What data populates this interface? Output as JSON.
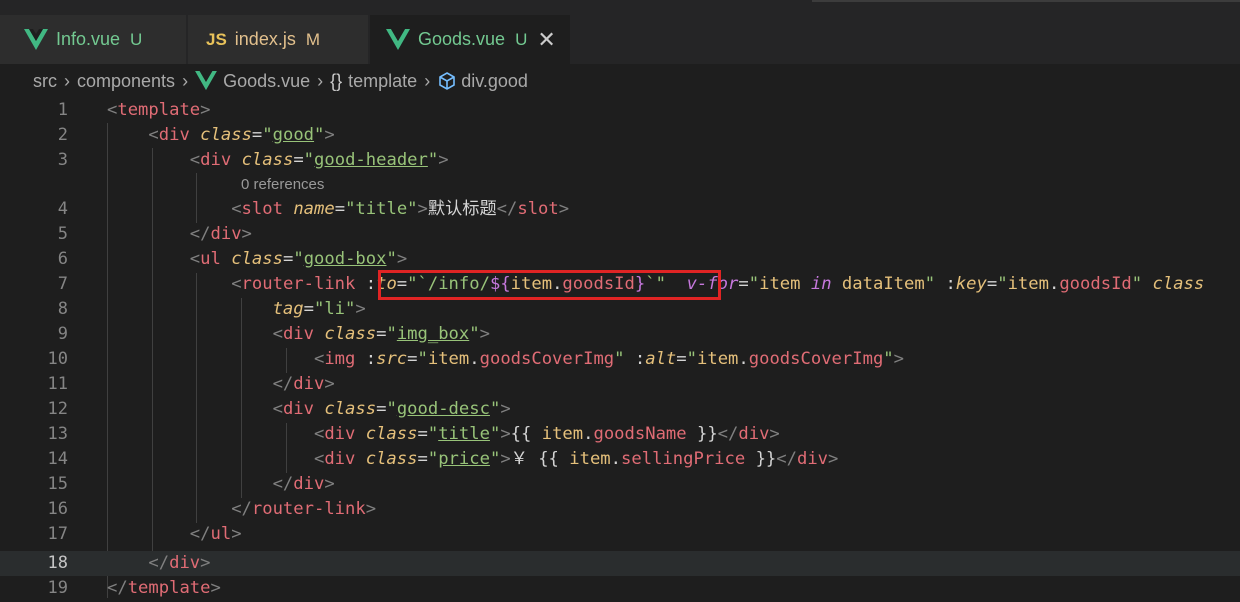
{
  "tabs": [
    {
      "label": "Info.vue",
      "status": "U",
      "icon": "vue-icon"
    },
    {
      "label": "index.js",
      "status": "M",
      "icon": "js-icon",
      "icon_text": "JS"
    },
    {
      "label": "Goods.vue",
      "status": "U",
      "icon": "vue-icon",
      "active": true,
      "close": "✕"
    }
  ],
  "breadcrumb": {
    "items": [
      "src",
      "components",
      "Goods.vue",
      "template",
      "div.good"
    ],
    "template_icon": "{}"
  },
  "editor": {
    "codelens": "0 references",
    "active_line": 18,
    "lines": [
      {
        "n": "1",
        "tokens": [
          [
            "br",
            "<"
          ],
          [
            "tag",
            "template"
          ],
          [
            "br",
            ">"
          ]
        ]
      },
      {
        "n": "2",
        "tokens": [
          [
            "t",
            "    "
          ],
          [
            "br",
            "<"
          ],
          [
            "tag",
            "div"
          ],
          [
            "t",
            " "
          ],
          [
            "attr",
            "class"
          ],
          [
            "eq",
            "="
          ],
          [
            "str",
            "\""
          ],
          [
            "cls",
            "good"
          ],
          [
            "str",
            "\""
          ],
          [
            "br",
            ">"
          ]
        ]
      },
      {
        "n": "3",
        "tokens": [
          [
            "t",
            "        "
          ],
          [
            "br",
            "<"
          ],
          [
            "tag",
            "div"
          ],
          [
            "t",
            " "
          ],
          [
            "attr",
            "class"
          ],
          [
            "eq",
            "="
          ],
          [
            "str",
            "\""
          ],
          [
            "cls",
            "good-header"
          ],
          [
            "str",
            "\""
          ],
          [
            "br",
            ">"
          ]
        ]
      },
      {
        "n": "4",
        "tokens": [
          [
            "t",
            "            "
          ],
          [
            "br",
            "<"
          ],
          [
            "tag",
            "slot"
          ],
          [
            "t",
            " "
          ],
          [
            "attr",
            "name"
          ],
          [
            "eq",
            "="
          ],
          [
            "str",
            "\"title\""
          ],
          [
            "br",
            ">"
          ],
          [
            "txt",
            "默认标题"
          ],
          [
            "br",
            "</"
          ],
          [
            "tag",
            "slot"
          ],
          [
            "br",
            ">"
          ]
        ]
      },
      {
        "n": "5",
        "tokens": [
          [
            "t",
            "        "
          ],
          [
            "br",
            "</"
          ],
          [
            "tag",
            "div"
          ],
          [
            "br",
            ">"
          ]
        ]
      },
      {
        "n": "6",
        "tokens": [
          [
            "t",
            "        "
          ],
          [
            "br",
            "<"
          ],
          [
            "tag",
            "ul"
          ],
          [
            "t",
            " "
          ],
          [
            "attr",
            "class"
          ],
          [
            "eq",
            "="
          ],
          [
            "str",
            "\""
          ],
          [
            "cls",
            "good-box"
          ],
          [
            "str",
            "\""
          ],
          [
            "br",
            ">"
          ]
        ]
      },
      {
        "n": "7",
        "tokens": [
          [
            "t",
            "            "
          ],
          [
            "br",
            "<"
          ],
          [
            "tag",
            "router-link"
          ],
          [
            "t",
            " "
          ],
          [
            "eq",
            ":"
          ],
          [
            "attr",
            "to"
          ],
          [
            "eq",
            "="
          ],
          [
            "str",
            "\"`/info/"
          ],
          [
            "int",
            "${"
          ],
          [
            "var",
            "item"
          ],
          [
            "p",
            "."
          ],
          [
            "prop",
            "goodsId"
          ],
          [
            "int",
            "}"
          ],
          [
            "str",
            "`\""
          ],
          [
            "t",
            "  "
          ],
          [
            "kw",
            "v-for"
          ],
          [
            "eq",
            "="
          ],
          [
            "str",
            "\""
          ],
          [
            "var",
            "item"
          ],
          [
            "t",
            " "
          ],
          [
            "kw",
            "in"
          ],
          [
            "t",
            " "
          ],
          [
            "var",
            "dataItem"
          ],
          [
            "str",
            "\""
          ],
          [
            "t",
            " "
          ],
          [
            "eq",
            ":"
          ],
          [
            "attr",
            "key"
          ],
          [
            "eq",
            "="
          ],
          [
            "str",
            "\""
          ],
          [
            "var",
            "item"
          ],
          [
            "p",
            "."
          ],
          [
            "prop",
            "goodsId"
          ],
          [
            "str",
            "\""
          ],
          [
            "t",
            " "
          ],
          [
            "attr",
            "class"
          ]
        ]
      },
      {
        "n": "8",
        "tokens": [
          [
            "t",
            "                "
          ],
          [
            "attr",
            "tag"
          ],
          [
            "eq",
            "="
          ],
          [
            "str",
            "\"li\""
          ],
          [
            "br",
            ">"
          ]
        ]
      },
      {
        "n": "9",
        "tokens": [
          [
            "t",
            "                "
          ],
          [
            "br",
            "<"
          ],
          [
            "tag",
            "div"
          ],
          [
            "t",
            " "
          ],
          [
            "attr",
            "class"
          ],
          [
            "eq",
            "="
          ],
          [
            "str",
            "\""
          ],
          [
            "cls",
            "img_box"
          ],
          [
            "str",
            "\""
          ],
          [
            "br",
            ">"
          ]
        ]
      },
      {
        "n": "10",
        "tokens": [
          [
            "t",
            "                    "
          ],
          [
            "br",
            "<"
          ],
          [
            "tag",
            "img"
          ],
          [
            "t",
            " "
          ],
          [
            "eq",
            ":"
          ],
          [
            "attr",
            "src"
          ],
          [
            "eq",
            "="
          ],
          [
            "str",
            "\""
          ],
          [
            "var",
            "item"
          ],
          [
            "p",
            "."
          ],
          [
            "prop",
            "goodsCoverImg"
          ],
          [
            "str",
            "\""
          ],
          [
            "t",
            " "
          ],
          [
            "eq",
            ":"
          ],
          [
            "attr",
            "alt"
          ],
          [
            "eq",
            "="
          ],
          [
            "str",
            "\""
          ],
          [
            "var",
            "item"
          ],
          [
            "p",
            "."
          ],
          [
            "prop",
            "goodsCoverImg"
          ],
          [
            "str",
            "\""
          ],
          [
            "br",
            ">"
          ]
        ]
      },
      {
        "n": "11",
        "tokens": [
          [
            "t",
            "                "
          ],
          [
            "br",
            "</"
          ],
          [
            "tag",
            "div"
          ],
          [
            "br",
            ">"
          ]
        ]
      },
      {
        "n": "12",
        "tokens": [
          [
            "t",
            "                "
          ],
          [
            "br",
            "<"
          ],
          [
            "tag",
            "div"
          ],
          [
            "t",
            " "
          ],
          [
            "attr",
            "class"
          ],
          [
            "eq",
            "="
          ],
          [
            "str",
            "\""
          ],
          [
            "cls",
            "good-desc"
          ],
          [
            "str",
            "\""
          ],
          [
            "br",
            ">"
          ]
        ]
      },
      {
        "n": "13",
        "tokens": [
          [
            "t",
            "                    "
          ],
          [
            "br",
            "<"
          ],
          [
            "tag",
            "div"
          ],
          [
            "t",
            " "
          ],
          [
            "attr",
            "class"
          ],
          [
            "eq",
            "="
          ],
          [
            "str",
            "\""
          ],
          [
            "cls",
            "title"
          ],
          [
            "str",
            "\""
          ],
          [
            "br",
            ">"
          ],
          [
            "txt",
            "{{ "
          ],
          [
            "var",
            "item"
          ],
          [
            "p",
            "."
          ],
          [
            "prop",
            "goodsName"
          ],
          [
            "txt",
            " }}"
          ],
          [
            "br",
            "</"
          ],
          [
            "tag",
            "div"
          ],
          [
            "br",
            ">"
          ]
        ]
      },
      {
        "n": "14",
        "tokens": [
          [
            "t",
            "                    "
          ],
          [
            "br",
            "<"
          ],
          [
            "tag",
            "div"
          ],
          [
            "t",
            " "
          ],
          [
            "attr",
            "class"
          ],
          [
            "eq",
            "="
          ],
          [
            "str",
            "\""
          ],
          [
            "cls",
            "price"
          ],
          [
            "str",
            "\""
          ],
          [
            "br",
            ">"
          ],
          [
            "txt",
            "￥ {{ "
          ],
          [
            "var",
            "item"
          ],
          [
            "p",
            "."
          ],
          [
            "prop",
            "sellingPrice"
          ],
          [
            "txt",
            " }}"
          ],
          [
            "br",
            "</"
          ],
          [
            "tag",
            "div"
          ],
          [
            "br",
            ">"
          ]
        ]
      },
      {
        "n": "15",
        "tokens": [
          [
            "t",
            "                "
          ],
          [
            "br",
            "</"
          ],
          [
            "tag",
            "div"
          ],
          [
            "br",
            ">"
          ]
        ]
      },
      {
        "n": "16",
        "tokens": [
          [
            "t",
            "            "
          ],
          [
            "br",
            "</"
          ],
          [
            "tag",
            "router-link"
          ],
          [
            "br",
            ">"
          ]
        ]
      },
      {
        "n": "17",
        "tokens": [
          [
            "t",
            "        "
          ],
          [
            "br",
            "</"
          ],
          [
            "tag",
            "ul"
          ],
          [
            "br",
            ">"
          ]
        ]
      },
      {
        "n": "18",
        "tokens": [
          [
            "t",
            "    "
          ],
          [
            "br",
            "</"
          ],
          [
            "tag",
            "div"
          ],
          [
            "br",
            ">"
          ]
        ]
      },
      {
        "n": "19",
        "tokens": [
          [
            "br",
            "</"
          ],
          [
            "tag",
            "template"
          ],
          [
            "br",
            ">"
          ]
        ]
      }
    ]
  },
  "colors": {
    "background": "#1e1e1e",
    "highlight_box": "#e02424",
    "untracked": "#73c991",
    "modified": "#e2c08d"
  }
}
